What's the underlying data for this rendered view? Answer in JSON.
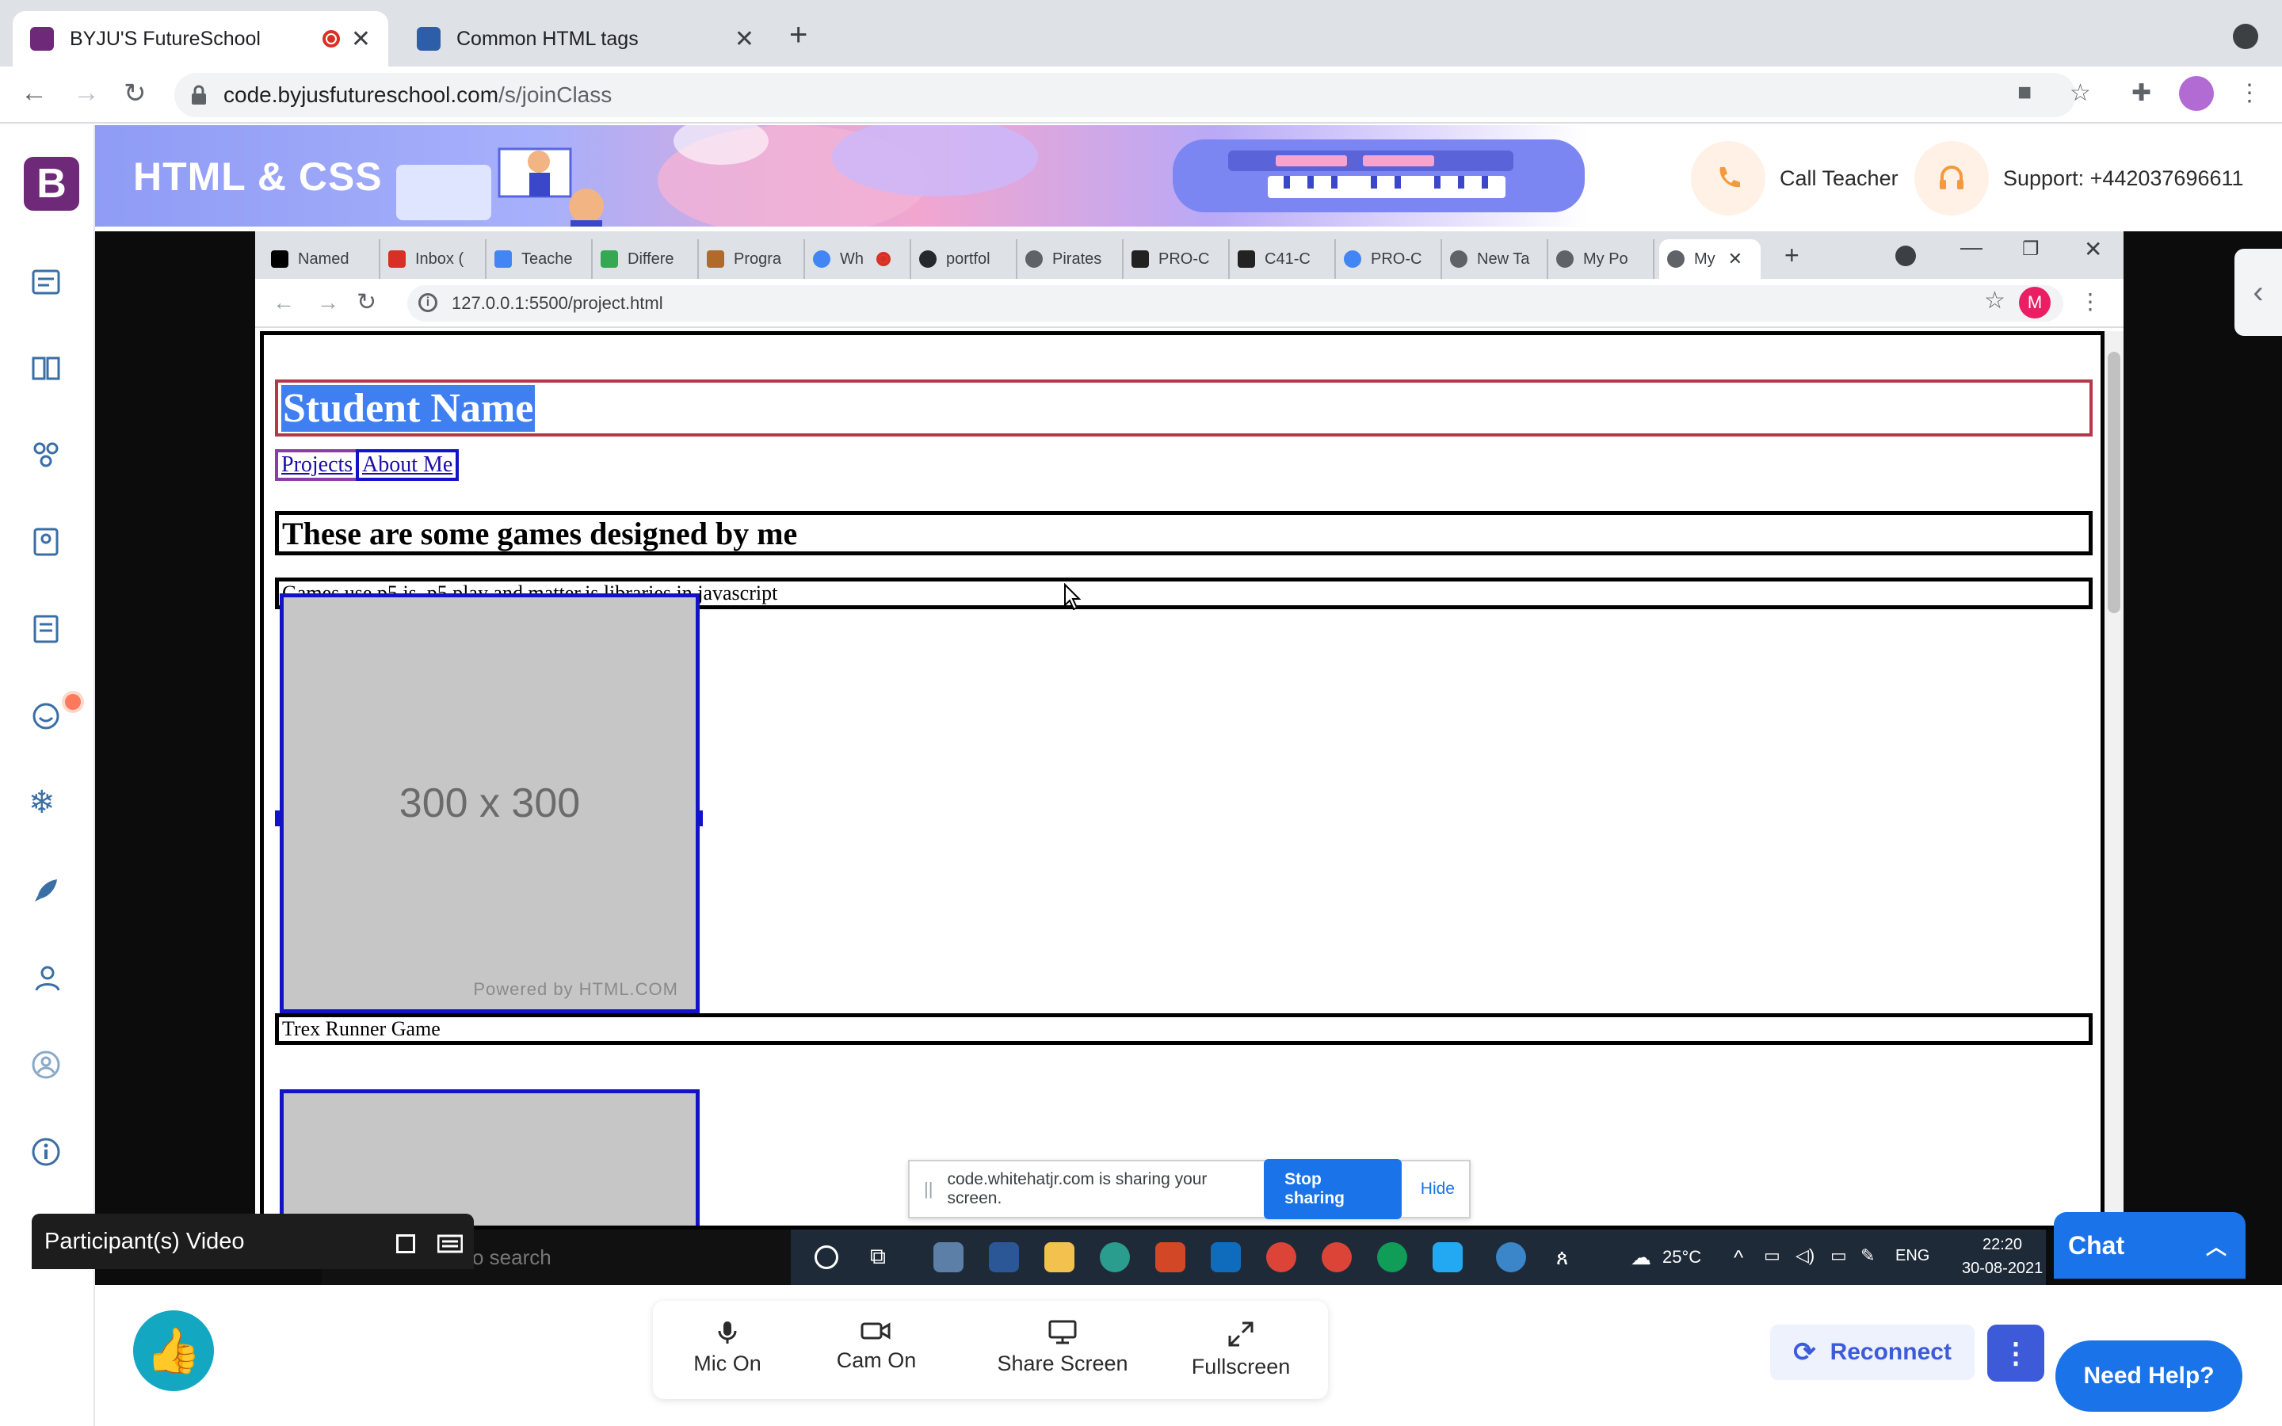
{
  "browser": {
    "tabs": [
      {
        "title": "BYJU'S FutureSchool",
        "favicon_color": "#6e2a78",
        "recording": true
      },
      {
        "title": "Common HTML tags",
        "favicon_color": "#2d5fa8"
      }
    ],
    "url_host": "code.byjusfutureschool.com",
    "url_path": "/s/joinClass"
  },
  "header": {
    "course_title": "HTML & CSS",
    "call_teacher": "Call Teacher",
    "support": "Support: +442037696611"
  },
  "sidebar": {
    "logo_letter": "B",
    "items": [
      "dashboard-icon",
      "book-icon",
      "activities-icon",
      "notebook-icon",
      "assignments-icon",
      "emoji-icon",
      "snowflake-icon",
      "rocket-icon",
      "support-icon",
      "profile-icon",
      "info-icon"
    ]
  },
  "shared_screen": {
    "tabs": [
      "Named",
      "Inbox (",
      "Teache",
      "Differe",
      "Progra",
      "Wh",
      "portfol",
      "Pirates",
      "PRO-C",
      "C41-C",
      "PRO-C",
      "New Ta",
      "My Po",
      "My"
    ],
    "url": "127.0.0.1:5500/project.html",
    "profile_letter": "M",
    "page": {
      "name": "Student Name",
      "links": [
        "Projects",
        "About Me"
      ],
      "heading": "These are some games designed by me",
      "paragraph": "Games use p5.js, p5.play and matter.js libraries in javascript",
      "image_text": "300 x 300",
      "image_credit": "Powered by HTML.COM",
      "caption": "Trex Runner Game"
    },
    "sharing_notice": {
      "text": "code.whitehatjr.com is sharing your screen.",
      "stop": "Stop sharing",
      "hide": "Hide"
    },
    "taskbar": {
      "search_text": "o search",
      "temperature": "25°C",
      "language": "ENG",
      "time": "22:20",
      "date": "30-08-2021"
    }
  },
  "participant_video": {
    "label": "Participant(s) Video"
  },
  "chat": {
    "label": "Chat"
  },
  "controls": [
    {
      "label": "Mic On",
      "icon": "mic-icon"
    },
    {
      "label": "Cam On",
      "icon": "camera-icon"
    },
    {
      "label": "Share Screen",
      "icon": "monitor-icon"
    },
    {
      "label": "Fullscreen",
      "icon": "fullscreen-icon"
    }
  ],
  "actions": {
    "reconnect": "Reconnect",
    "need_help": "Need Help?"
  }
}
